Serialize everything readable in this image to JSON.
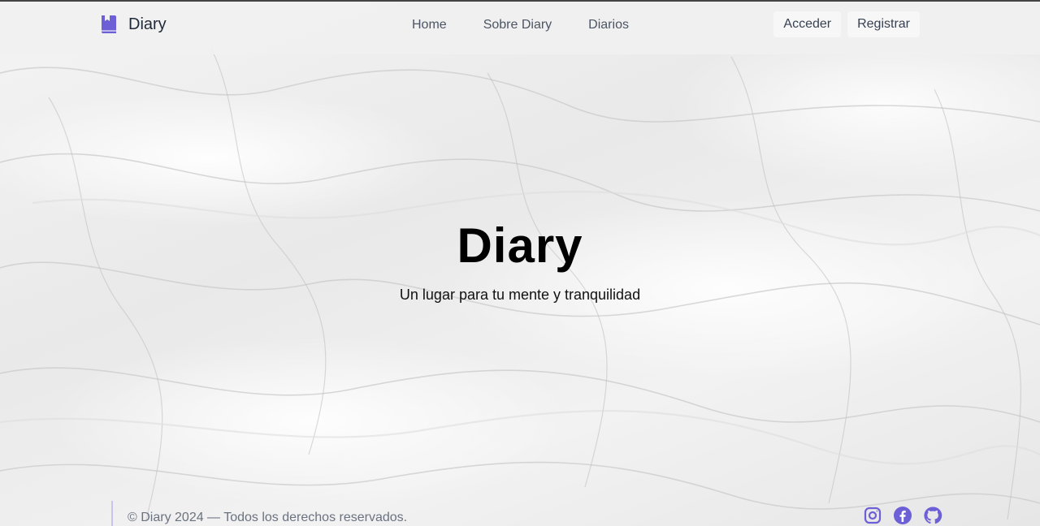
{
  "brand": {
    "name": "Diary",
    "icon": "diary-book-icon"
  },
  "nav": {
    "items": [
      {
        "label": "Home"
      },
      {
        "label": "Sobre Diary"
      },
      {
        "label": "Diarios"
      }
    ]
  },
  "auth": {
    "login_label": "Acceder",
    "register_label": "Registrar"
  },
  "hero": {
    "title": "Diary",
    "subtitle": "Un lugar para tu mente y tranquilidad"
  },
  "footer": {
    "copyright": "© Diary 2024 — Todos los derechos reservados.",
    "social": [
      "instagram-icon",
      "facebook-icon",
      "github-icon"
    ]
  },
  "colors": {
    "accent": "#6d5fd6",
    "footer_border": "#c7c4ee",
    "text_dark": "#1f2937",
    "text_muted": "#6b7280"
  }
}
